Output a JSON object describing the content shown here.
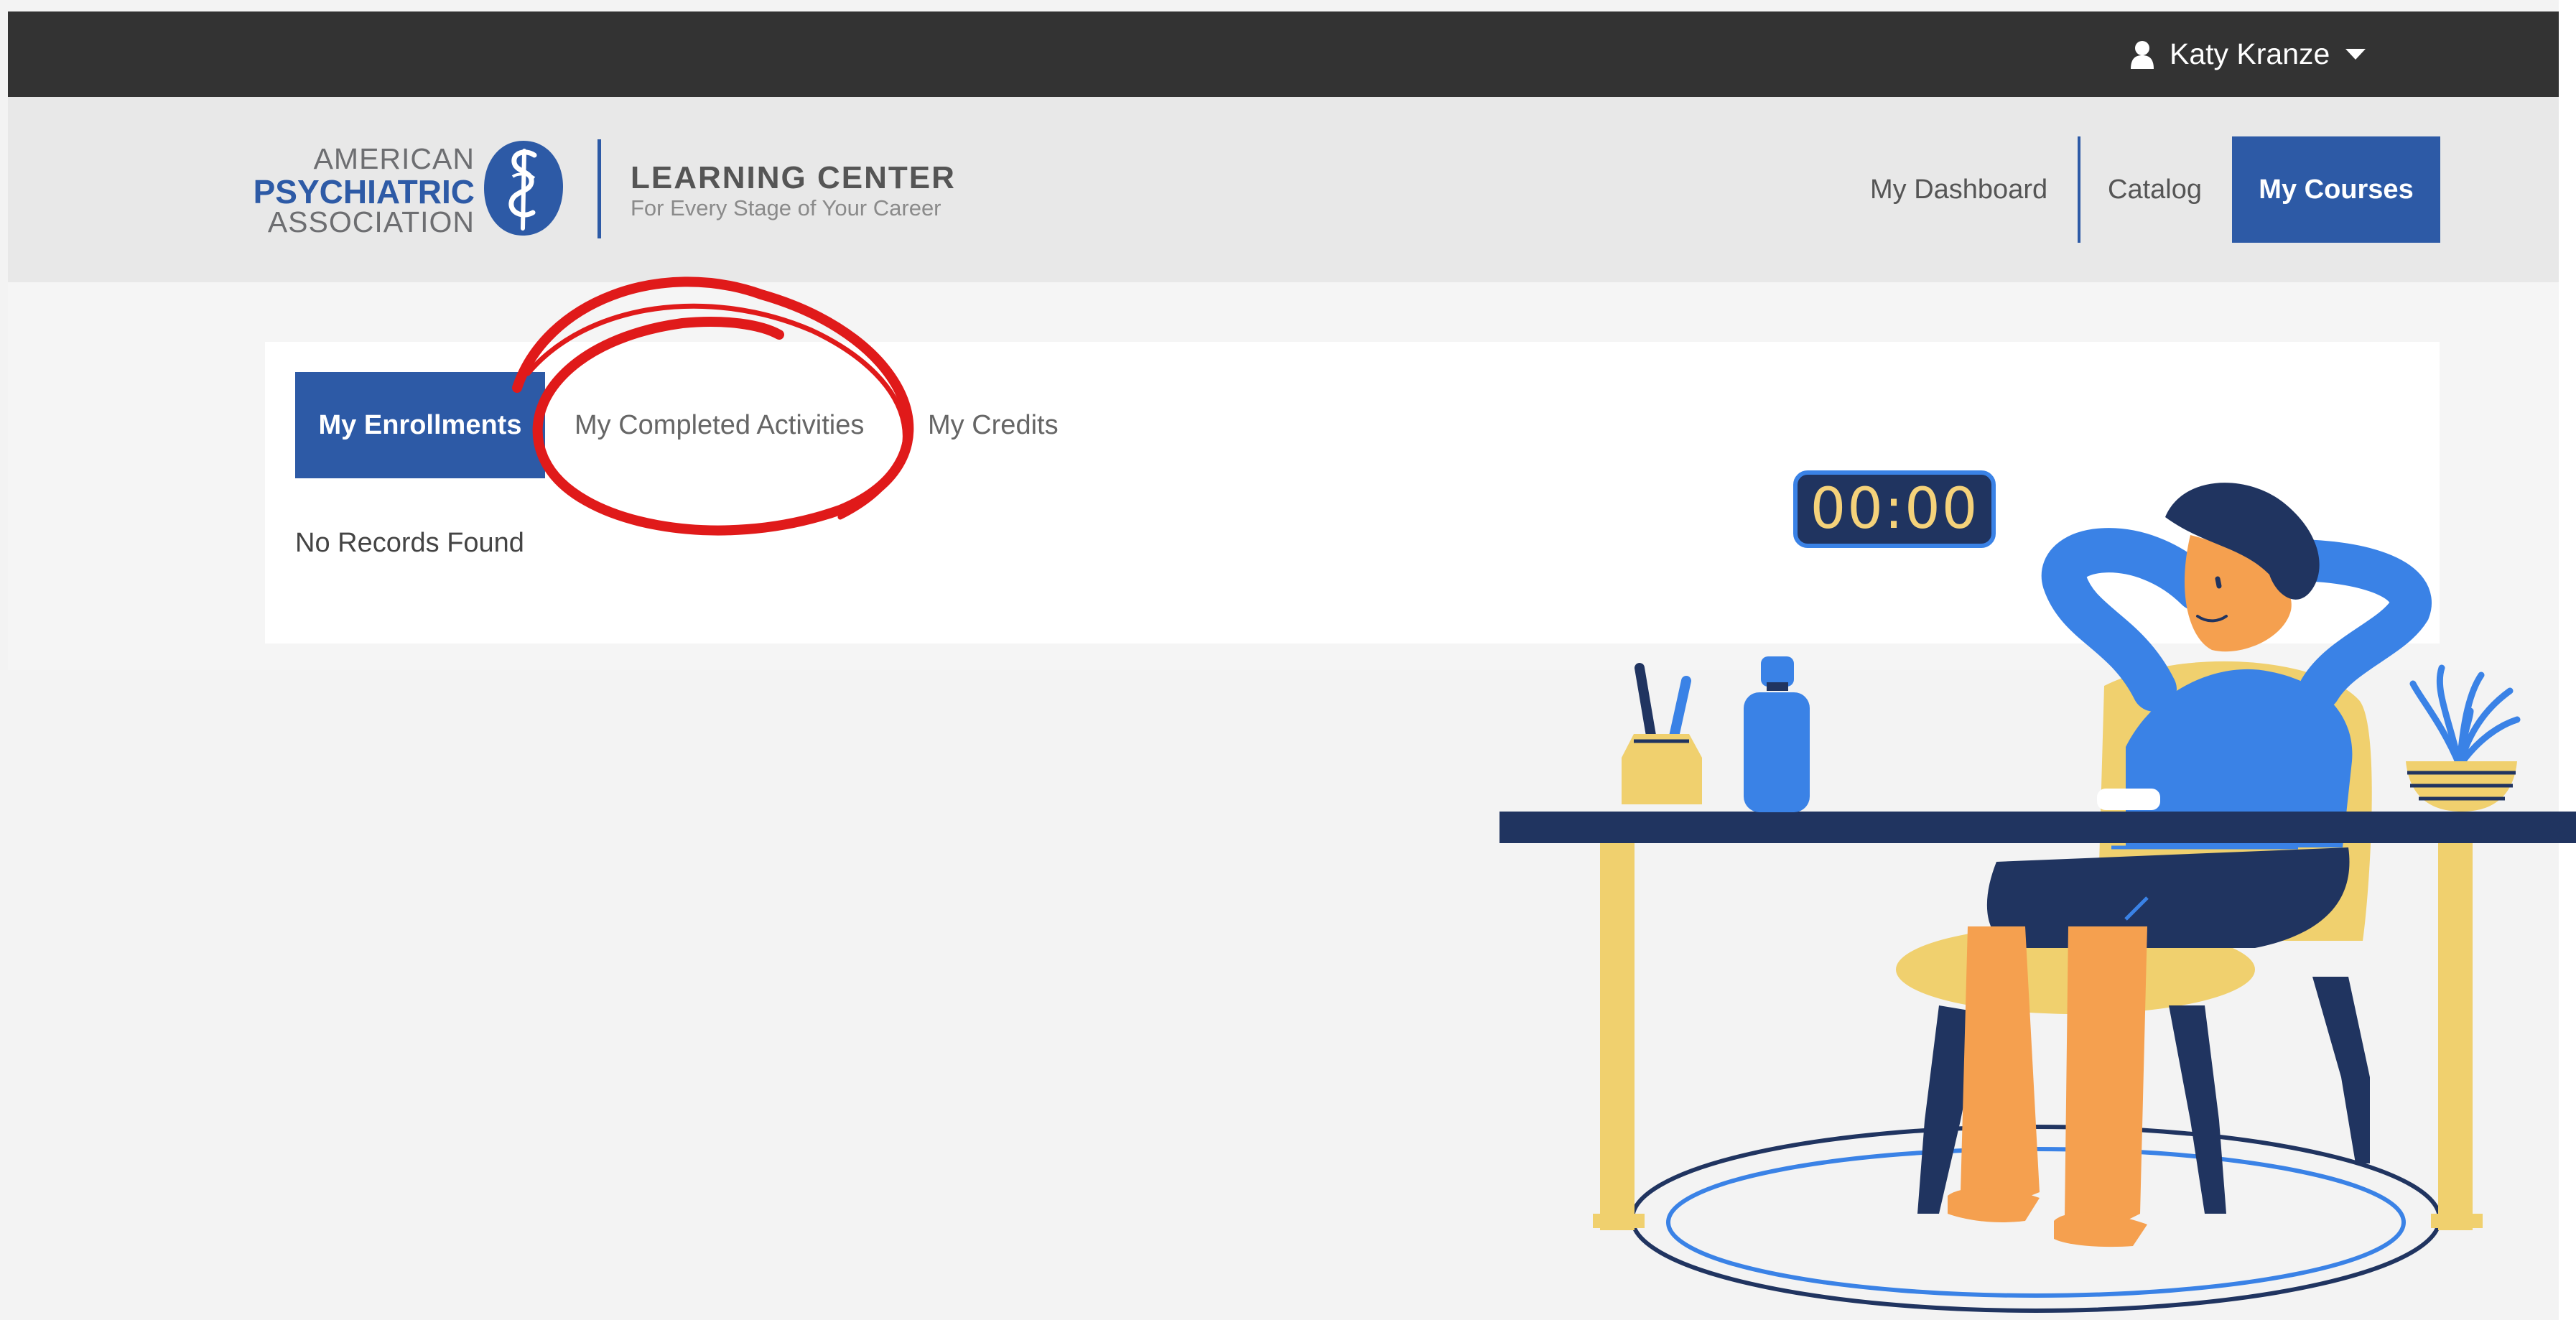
{
  "topbar": {
    "user_name": "Katy Kranze"
  },
  "header": {
    "logo": {
      "org_line1": "AMERICAN",
      "org_line2": "PSYCHIATRIC",
      "org_line3": "ASSOCIATION",
      "product_title": "LEARNING CENTER",
      "product_subtitle": "For Every Stage of Your Career"
    },
    "nav": [
      {
        "label": "My Dashboard"
      },
      {
        "label": "Catalog"
      },
      {
        "label": "My Courses",
        "active": true
      }
    ]
  },
  "main": {
    "tabs": [
      {
        "label": "My Enrollments",
        "active": true
      },
      {
        "label": "My Completed Activities"
      },
      {
        "label": "My Credits"
      }
    ],
    "empty_message": "No Records Found"
  },
  "overlay": {
    "timer": "00:00",
    "annotation_color": "#e01a1a"
  },
  "colors": {
    "brand_blue": "#2d5aa6",
    "topbar_bg": "#333333",
    "header_bg": "#e8e8e8"
  }
}
